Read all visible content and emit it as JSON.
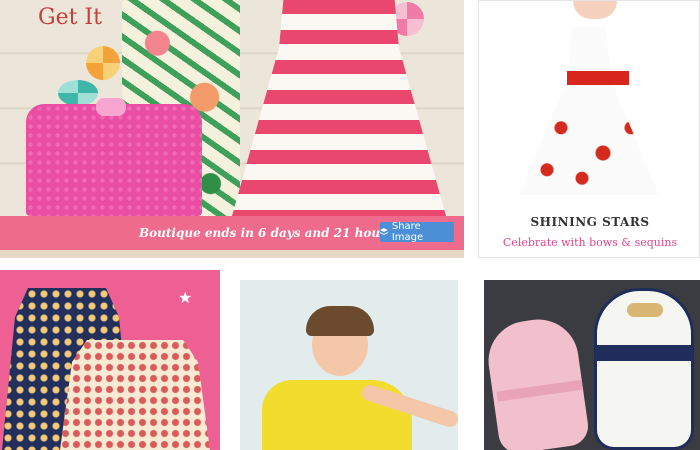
{
  "featured_card": {
    "title": "Get It",
    "banner_text": "Boutique ends in 6 days and 21 hours",
    "share_label": "Share Image",
    "share_icon": "share-icon"
  },
  "card_shining_stars": {
    "title": "SHINING STARS",
    "subtitle": "Celebrate with bows & sequins"
  },
  "colors": {
    "banner": "#ee6b8c",
    "share_button": "#4b8fd6",
    "subtitle_pink": "#e0458d",
    "title_red": "#c43f3a"
  }
}
